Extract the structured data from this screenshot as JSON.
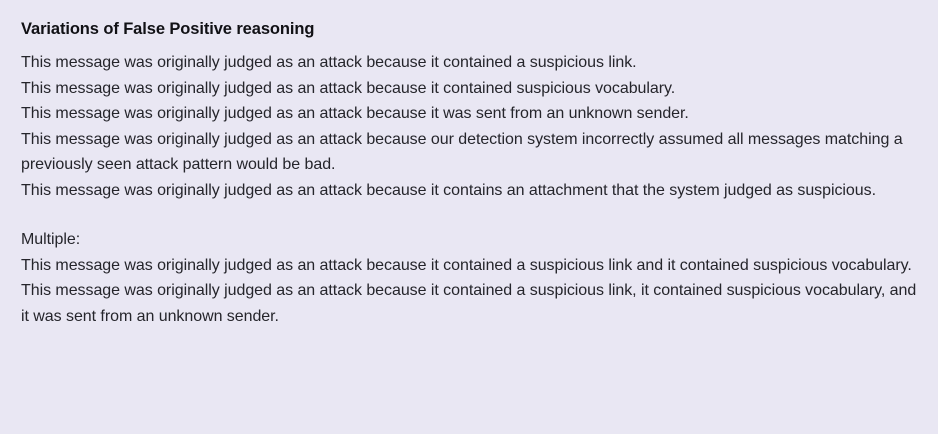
{
  "document": {
    "title": "Variations of False Positive reasoning",
    "single_reasons": [
      "This message was originally judged as an attack because it contained a suspicious link.",
      "This message was originally judged as an attack because it contained suspicious vocabulary.",
      "This message was originally judged as an attack because it was sent from an unknown sender.",
      "This message was originally judged as an attack because our detection system incorrectly assumed all messages matching a previously seen attack pattern would be bad.",
      "This message was originally judged as an attack because it contains an attachment that the system judged as suspicious."
    ],
    "multiple_heading": "Multiple:",
    "multiple_reasons": [
      "This message was originally judged as an attack because it contained a suspicious link and it contained suspicious vocabulary.",
      "This message was originally judged as an attack because it contained a suspicious link, it contained suspicious vocabulary, and it was sent from an unknown sender."
    ]
  }
}
